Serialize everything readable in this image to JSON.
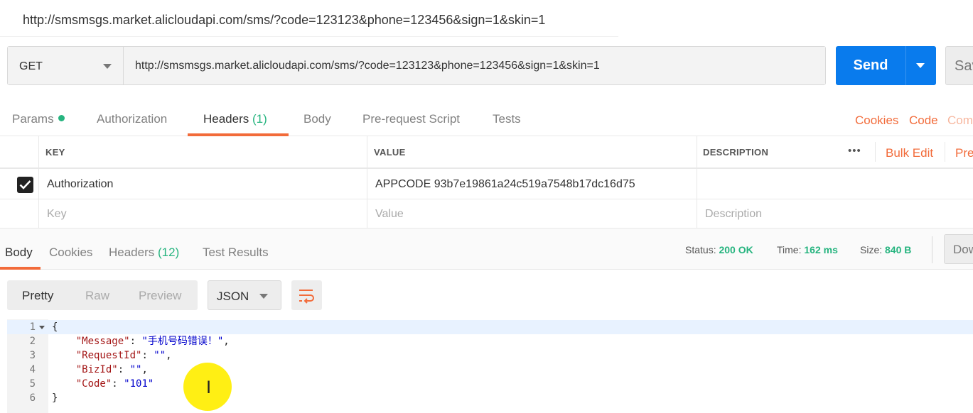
{
  "window": {
    "title": "http://smsmsgs.market.alicloudapi.com/sms/?code=123123&phone=123456&sign=1&skin=1"
  },
  "request": {
    "method": "GET",
    "url": "http://smsmsgs.market.alicloudapi.com/sms/?code=123123&phone=123456&sign=1&skin=1",
    "send_label": "Send",
    "save_label": "Save"
  },
  "req_tabs": {
    "params": "Params",
    "authorization": "Authorization",
    "headers": "Headers",
    "headers_count": "(1)",
    "body": "Body",
    "prerequest": "Pre-request Script",
    "tests": "Tests",
    "cookies": "Cookies",
    "code": "Code",
    "comments": "Comments"
  },
  "headers_table": {
    "col_key": "KEY",
    "col_value": "VALUE",
    "col_description": "DESCRIPTION",
    "more": "•••",
    "bulk_edit": "Bulk Edit",
    "presets": "Presets",
    "rows": [
      {
        "checked": true,
        "key": "Authorization",
        "value": "APPCODE 93b7e19861a24c519a7548b17dc16d75",
        "description": ""
      }
    ],
    "placeholder_key": "Key",
    "placeholder_value": "Value",
    "placeholder_description": "Description"
  },
  "response_tabs": {
    "body": "Body",
    "cookies": "Cookies",
    "headers": "Headers",
    "headers_count": "(12)",
    "test_results": "Test Results",
    "download": "Download"
  },
  "status": {
    "status_label": "Status:",
    "status_value": "200 OK",
    "time_label": "Time:",
    "time_value": "162 ms",
    "size_label": "Size:",
    "size_value": "840 B"
  },
  "format": {
    "pretty": "Pretty",
    "raw": "Raw",
    "preview": "Preview",
    "type": "JSON",
    "wrap_icon": "wrap-lines-icon"
  },
  "code_lines": [
    {
      "num": "1",
      "text": "{"
    },
    {
      "num": "2",
      "key": "\"Message\"",
      "val": "\"手机号码错误！\"",
      "tail": ","
    },
    {
      "num": "3",
      "key": "\"RequestId\"",
      "val": "\"\"",
      "tail": ","
    },
    {
      "num": "4",
      "key": "\"BizId\"",
      "val": "\"\"",
      "tail": ","
    },
    {
      "num": "5",
      "key": "\"Code\"",
      "val": "\"101\"",
      "tail": ""
    },
    {
      "num": "6",
      "text": "}"
    }
  ],
  "colors": {
    "accent": "#f26b3a",
    "send": "#097bed",
    "success": "#26b47f"
  }
}
